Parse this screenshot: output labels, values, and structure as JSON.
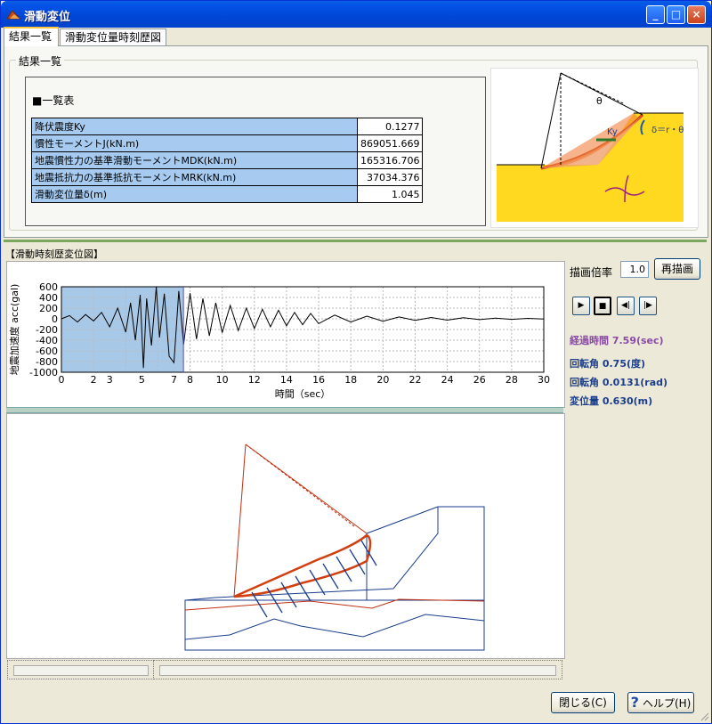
{
  "window": {
    "title": "滑動変位",
    "icon": "landslide-app-icon",
    "controls": {
      "minimize": "_",
      "maximize": "□",
      "close": "×"
    }
  },
  "tabs": [
    {
      "label": "結果一覧",
      "active": true
    },
    {
      "label": "滑動変位量時刻歴図",
      "active": false
    }
  ],
  "results": {
    "group_label": "結果一覧",
    "table_title": "■一覧表",
    "rows": [
      {
        "label": "降伏震度Ky",
        "value": "0.1277"
      },
      {
        "label": "慣性モーメントJ(kN.m)",
        "value": "869051.669"
      },
      {
        "label": "地震慣性力の基準滑動モーメントMDK(kN.m)",
        "value": "165316.706"
      },
      {
        "label": "地震抵抗力の基準抵抗モーメントMRK(kN.m)",
        "value": "37034.376"
      },
      {
        "label": "滑動変位量δ(m)",
        "value": "1.045"
      }
    ],
    "diagram": {
      "theta": "θ",
      "ky": "Ky",
      "delta_formula": "δ＝r・θ"
    }
  },
  "history": {
    "section_label": "【滑動時刻歴変位図】",
    "scale_label": "描画倍率",
    "scale_value": "1.0",
    "redraw_label": "再描画",
    "playback": {
      "play": "▶",
      "stop": "■",
      "step_back": "◀|",
      "step_forward": "|▶"
    },
    "elapsed": "経過時間 7.59(sec)",
    "rot_deg": "回転角 0.75(度)",
    "rot_rad": "回転角 0.0131(rad)",
    "displacement": "変位量 0.630(m)"
  },
  "chart_data": {
    "type": "line",
    "title": "",
    "xlabel": "時間（sec）",
    "ylabel": "地震加速度 acc(gal)",
    "xlim": [
      0,
      30
    ],
    "ylim": [
      -1000,
      600
    ],
    "x_ticks": [
      "0",
      "2",
      "3",
      "5",
      "7",
      "8",
      "10",
      "12",
      "14",
      "16",
      "18",
      "20",
      "22",
      "24",
      "26",
      "28",
      "30"
    ],
    "y_ticks": [
      "600",
      "400",
      "200",
      "0",
      "-200",
      "-400",
      "-600",
      "-800",
      "-1000"
    ],
    "highlight_until": 7.59,
    "series": [
      {
        "name": "",
        "x": [
          0,
          0.5,
          1,
          1.5,
          2,
          2.5,
          3,
          3.5,
          4,
          4.3,
          4.6,
          4.9,
          5.1,
          5.3,
          5.6,
          5.9,
          6.1,
          6.4,
          6.7,
          7,
          7.3,
          7.6,
          8,
          8.4,
          8.8,
          9.2,
          9.6,
          10,
          10.5,
          11,
          11.5,
          12,
          12.5,
          13,
          13.5,
          14,
          14.5,
          15,
          15.5,
          16,
          17,
          18,
          19,
          20,
          21,
          22,
          23,
          24,
          25,
          26,
          27,
          28,
          29,
          30
        ],
        "y": [
          0,
          60,
          -60,
          80,
          -40,
          120,
          -150,
          200,
          -250,
          300,
          -400,
          450,
          -920,
          380,
          -500,
          600,
          -350,
          470,
          -700,
          -820,
          520,
          -480,
          480,
          -380,
          380,
          -320,
          300,
          -260,
          250,
          -220,
          200,
          -180,
          180,
          -150,
          160,
          -130,
          120,
          -110,
          100,
          -90,
          70,
          -60,
          50,
          -45,
          35,
          -30,
          25,
          -25,
          20,
          -15,
          12,
          -10,
          8,
          -5
        ]
      }
    ]
  },
  "buttons": {
    "close": "閉じる(C)",
    "help": "ヘルプ(H)"
  }
}
